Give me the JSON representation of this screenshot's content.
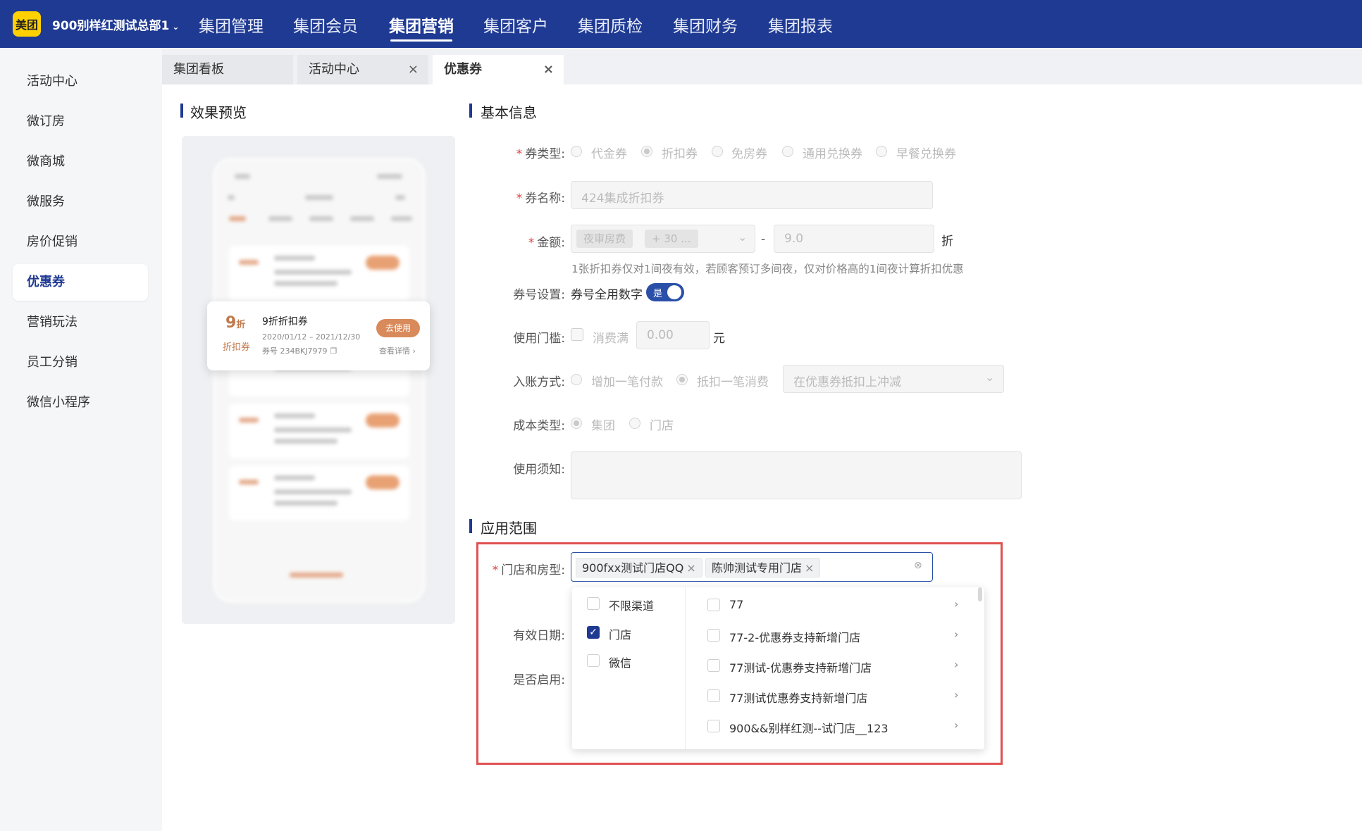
{
  "brand": {
    "logo": "美团",
    "org": "900别样红测试总部1"
  },
  "nav": [
    "集团管理",
    "集团会员",
    "集团营销",
    "集团客户",
    "集团质检",
    "集团财务",
    "集团报表"
  ],
  "sidebar": [
    "活动中心",
    "微订房",
    "微商城",
    "微服务",
    "房价促销",
    "优惠券",
    "营销玩法",
    "员工分销",
    "微信小程序"
  ],
  "tabs": [
    "集团看板",
    "活动中心",
    "优惠券"
  ],
  "preview": {
    "title": "效果预览",
    "coupon": {
      "discount": "9",
      "unit": "折",
      "type": "折扣券",
      "name": "9折折扣券",
      "dates": "2020/01/12 – 2021/12/30",
      "code": "券号 234BKJ7979",
      "use_btn": "去使用",
      "detail": "查看详情"
    }
  },
  "basic": {
    "title": "基本信息",
    "type_label": "券类型:",
    "types": [
      "代金券",
      "折扣券",
      "免房券",
      "通用兑换券",
      "早餐兑换券"
    ],
    "name_label": "券名称:",
    "name_value": "424集成折扣券",
    "amount_label": "金额:",
    "amount_tag1": "夜审房费",
    "amount_tag2": "+ 30 ...",
    "amount_dash": "-",
    "amount_value": "9.0",
    "amount_unit": "折",
    "amount_hint": "1张折扣券仅对1间夜有效，若顾客预订多间夜，仅对价格高的1间夜计算折扣优惠",
    "code_label": "券号设置:",
    "code_text": "券号全用数字",
    "toggle": "是",
    "threshold_label": "使用门槛:",
    "threshold_text": "消费满",
    "threshold_value": "0.00",
    "threshold_unit": "元",
    "acct_label": "入账方式:",
    "acct_opts": [
      "增加一笔付款",
      "抵扣一笔消费"
    ],
    "acct_select": "在优惠券抵扣上冲减",
    "cost_label": "成本类型:",
    "cost_opts": [
      "集团",
      "门店"
    ],
    "notice_label": "使用须知:"
  },
  "scope": {
    "title": "应用范围",
    "store_label": "门店和房型:",
    "tags": [
      "900fxx测试门店QQ",
      "陈帅测试专用门店"
    ],
    "valid_label": "有效日期:",
    "enable_label": "是否启用:",
    "channels": [
      "不限渠道",
      "门店",
      "微信"
    ],
    "stores": [
      "77",
      "77-2-优惠券支持新增门店",
      "77测试-优惠券支持新增门店",
      "77测试优惠券支持新增门店",
      "900&&别样红测--试门店__123"
    ]
  },
  "colors": {
    "primary": "#1f3a93",
    "highlight": "#e05050"
  }
}
